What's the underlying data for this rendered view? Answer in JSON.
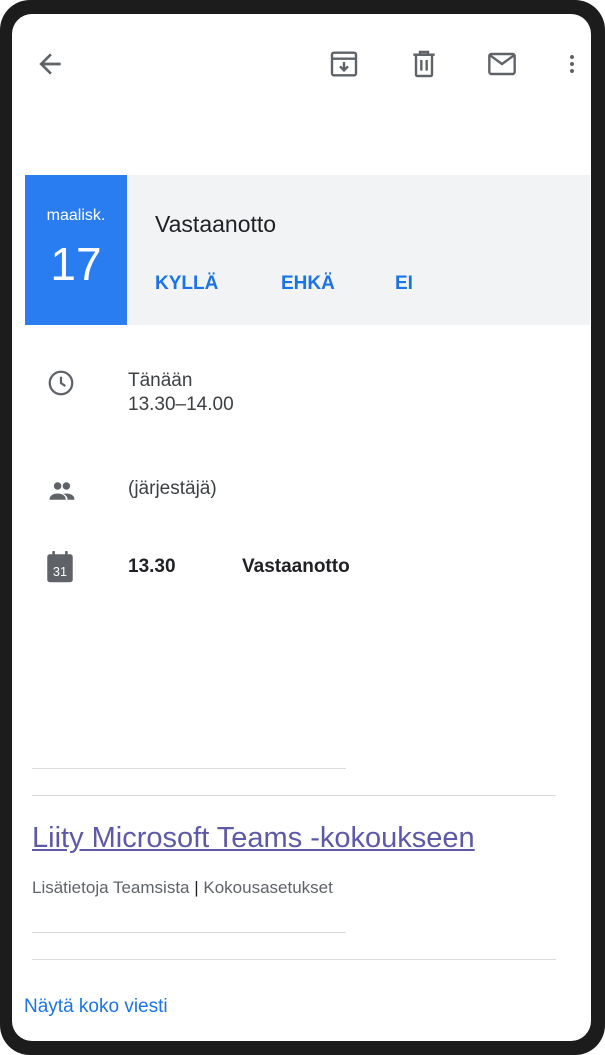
{
  "toolbar": {
    "back_icon": "arrow-back-icon",
    "archive_icon": "archive-icon",
    "delete_icon": "trash-icon",
    "mark_unread_icon": "mail-icon",
    "more_icon": "more-vert-icon"
  },
  "event": {
    "month": "maalisk.",
    "day": "17",
    "title": "Vastaanotto",
    "rsvp_yes": "KYLLÄ",
    "rsvp_maybe": "EHKÄ",
    "rsvp_no": "EI",
    "accent_color": "#2a7df0"
  },
  "details": {
    "when_day": "Tänään",
    "when_time": "13.30–14.00",
    "organizer": "(järjestäjä)",
    "agenda_time": "13.30",
    "agenda_title": "Vastaanotto",
    "calendar_icon_day": "31"
  },
  "teams": {
    "join_link": "Liity Microsoft Teams -kokoukseen",
    "learn_more": "Lisätietoja Teamsista",
    "separator": "|",
    "meeting_options": "Kokousasetukset"
  },
  "footer": {
    "show_full_message": "Näytä koko viesti"
  }
}
